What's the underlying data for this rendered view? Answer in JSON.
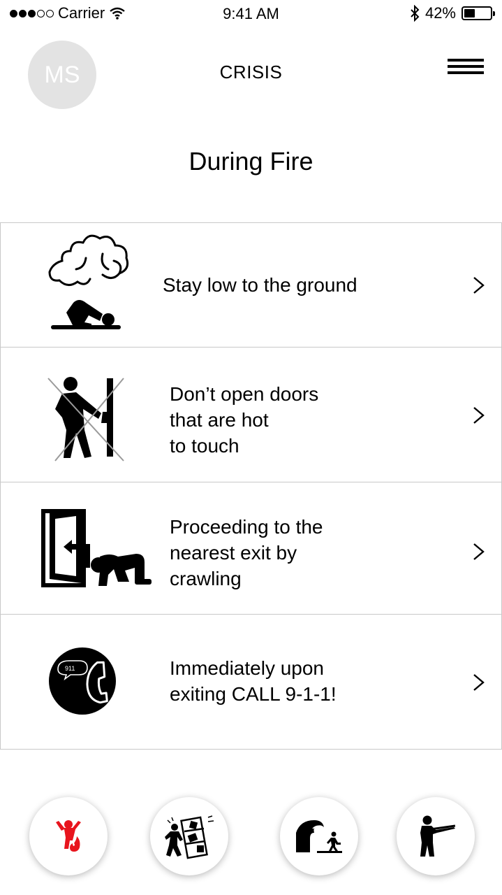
{
  "status_bar": {
    "carrier": "Carrier",
    "time": "9:41 AM",
    "battery": "42%",
    "battery_level": 0.42,
    "signal_bars_filled": 3,
    "signal_bars_total": 5
  },
  "header": {
    "avatar_initials": "MS",
    "title": "CRISIS"
  },
  "page_title": "During Fire",
  "items": [
    {
      "text": "Stay low to the ground",
      "icon": "smoke-crawl-icon"
    },
    {
      "text": "Don’t open doors\nthat are hot\nto touch",
      "icon": "hot-door-icon"
    },
    {
      "text": "Proceeding to the\nnearest exit by\ncrawling",
      "icon": "crawl-exit-icon"
    },
    {
      "text": "Immediately upon\nexiting CALL 9-1-1!",
      "icon": "phone-911-icon",
      "badge": "911"
    }
  ],
  "bottom_nav": [
    {
      "name": "fire",
      "icon": "fire-person-icon",
      "color": "#e8141d"
    },
    {
      "name": "earthquake",
      "icon": "earthquake-icon",
      "color": "#000000"
    },
    {
      "name": "tsunami",
      "icon": "tsunami-icon",
      "color": "#000000"
    },
    {
      "name": "shooter",
      "icon": "shooter-icon",
      "color": "#000000"
    }
  ]
}
